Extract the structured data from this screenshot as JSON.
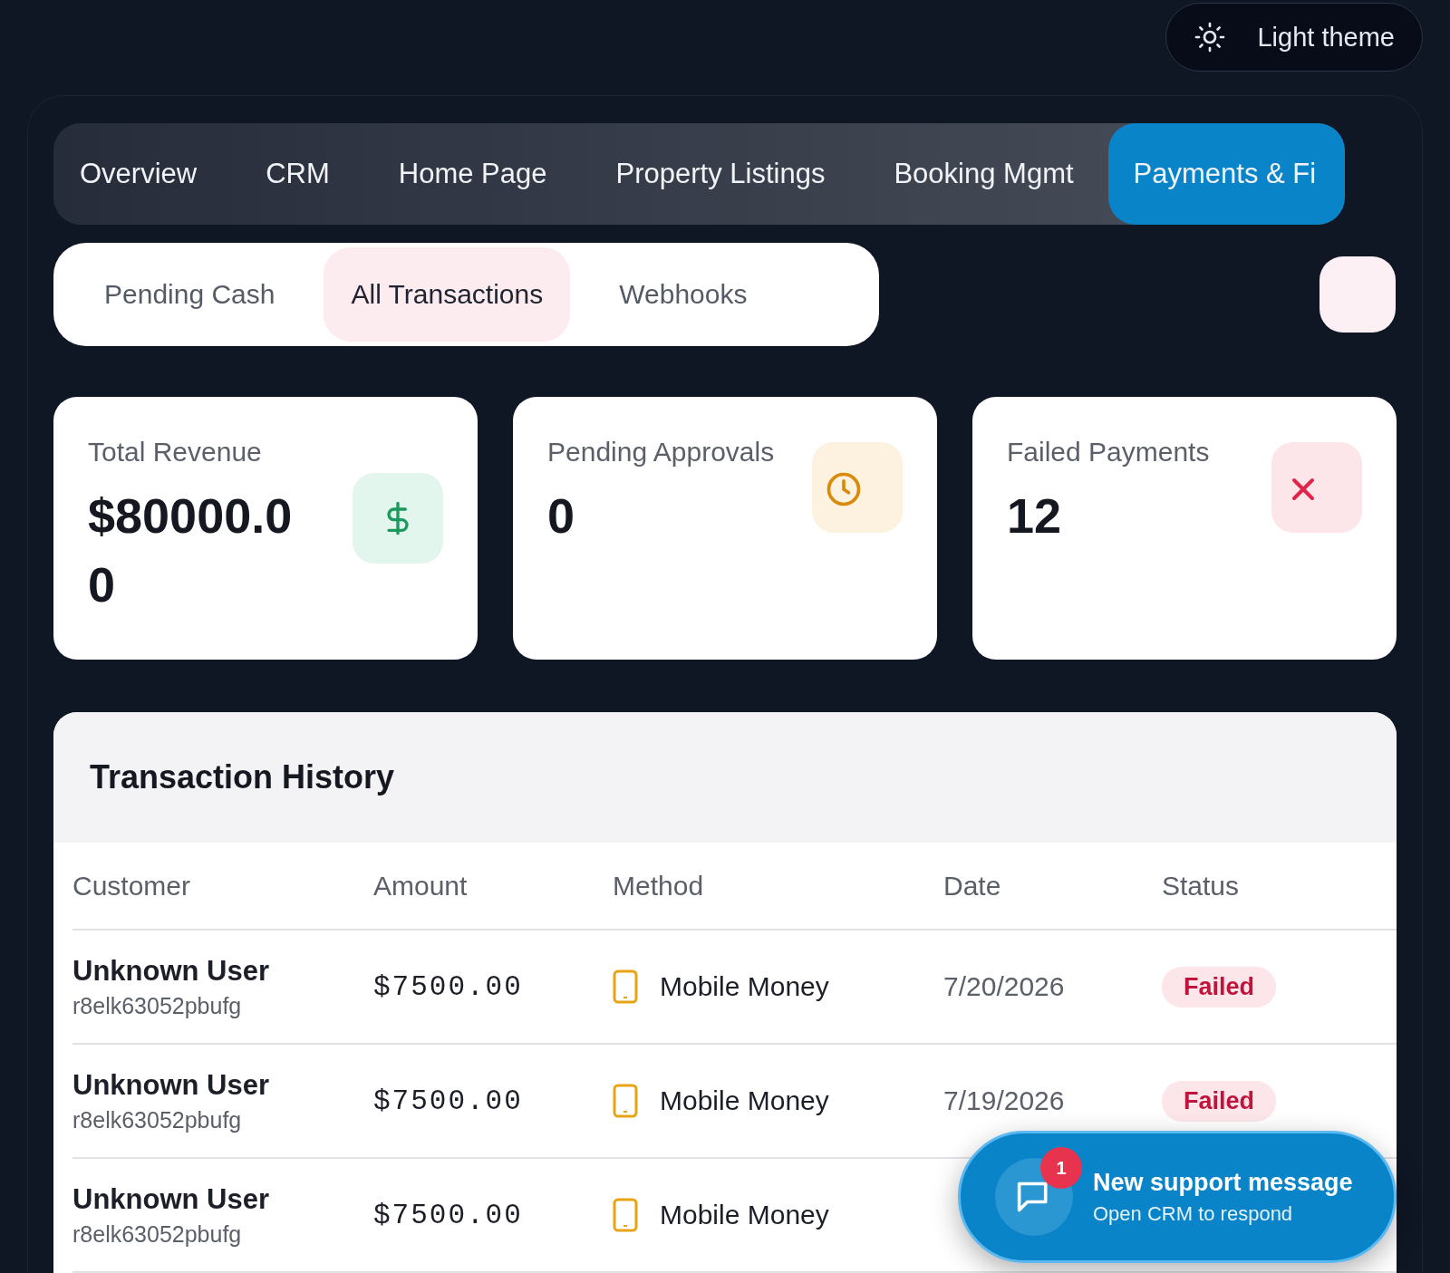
{
  "theme_button": {
    "label": "Light theme"
  },
  "tabs": [
    {
      "label": "Overview",
      "selected": false
    },
    {
      "label": "CRM",
      "selected": false
    },
    {
      "label": "Home Page",
      "selected": false
    },
    {
      "label": "Property Listings",
      "selected": false
    },
    {
      "label": "Booking Mgmt",
      "selected": false
    },
    {
      "label": "Payments & Fi",
      "selected": true
    }
  ],
  "sub_tabs": [
    {
      "label": "Pending Cash",
      "selected": false
    },
    {
      "label": "All Transactions",
      "selected": true
    },
    {
      "label": "Webhooks",
      "selected": false
    }
  ],
  "stats": [
    {
      "label": "Total Revenue",
      "value": "$80000.00",
      "kind": "revenue"
    },
    {
      "label": "Pending Approvals",
      "value": "0",
      "kind": "pending"
    },
    {
      "label": "Failed Payments",
      "value": "12",
      "kind": "failed"
    }
  ],
  "table": {
    "title": "Transaction History",
    "columns": [
      "Customer",
      "Amount",
      "Method",
      "Date",
      "Status"
    ],
    "rows": [
      {
        "customer": "Unknown User",
        "customer_id": "r8elk63052pbufg",
        "amount": "$7500.00",
        "method": "Mobile Money",
        "date": "7/20/2026",
        "status": "Failed"
      },
      {
        "customer": "Unknown User",
        "customer_id": "r8elk63052pbufg",
        "amount": "$7500.00",
        "method": "Mobile Money",
        "date": "7/19/2026",
        "status": "Failed"
      },
      {
        "customer": "Unknown User",
        "customer_id": "r8elk63052pbufg",
        "amount": "$7500.00",
        "method": "Mobile Money"
      }
    ]
  },
  "toast": {
    "title": "New support message",
    "subtitle": "Open CRM to respond",
    "badge": "1"
  }
}
